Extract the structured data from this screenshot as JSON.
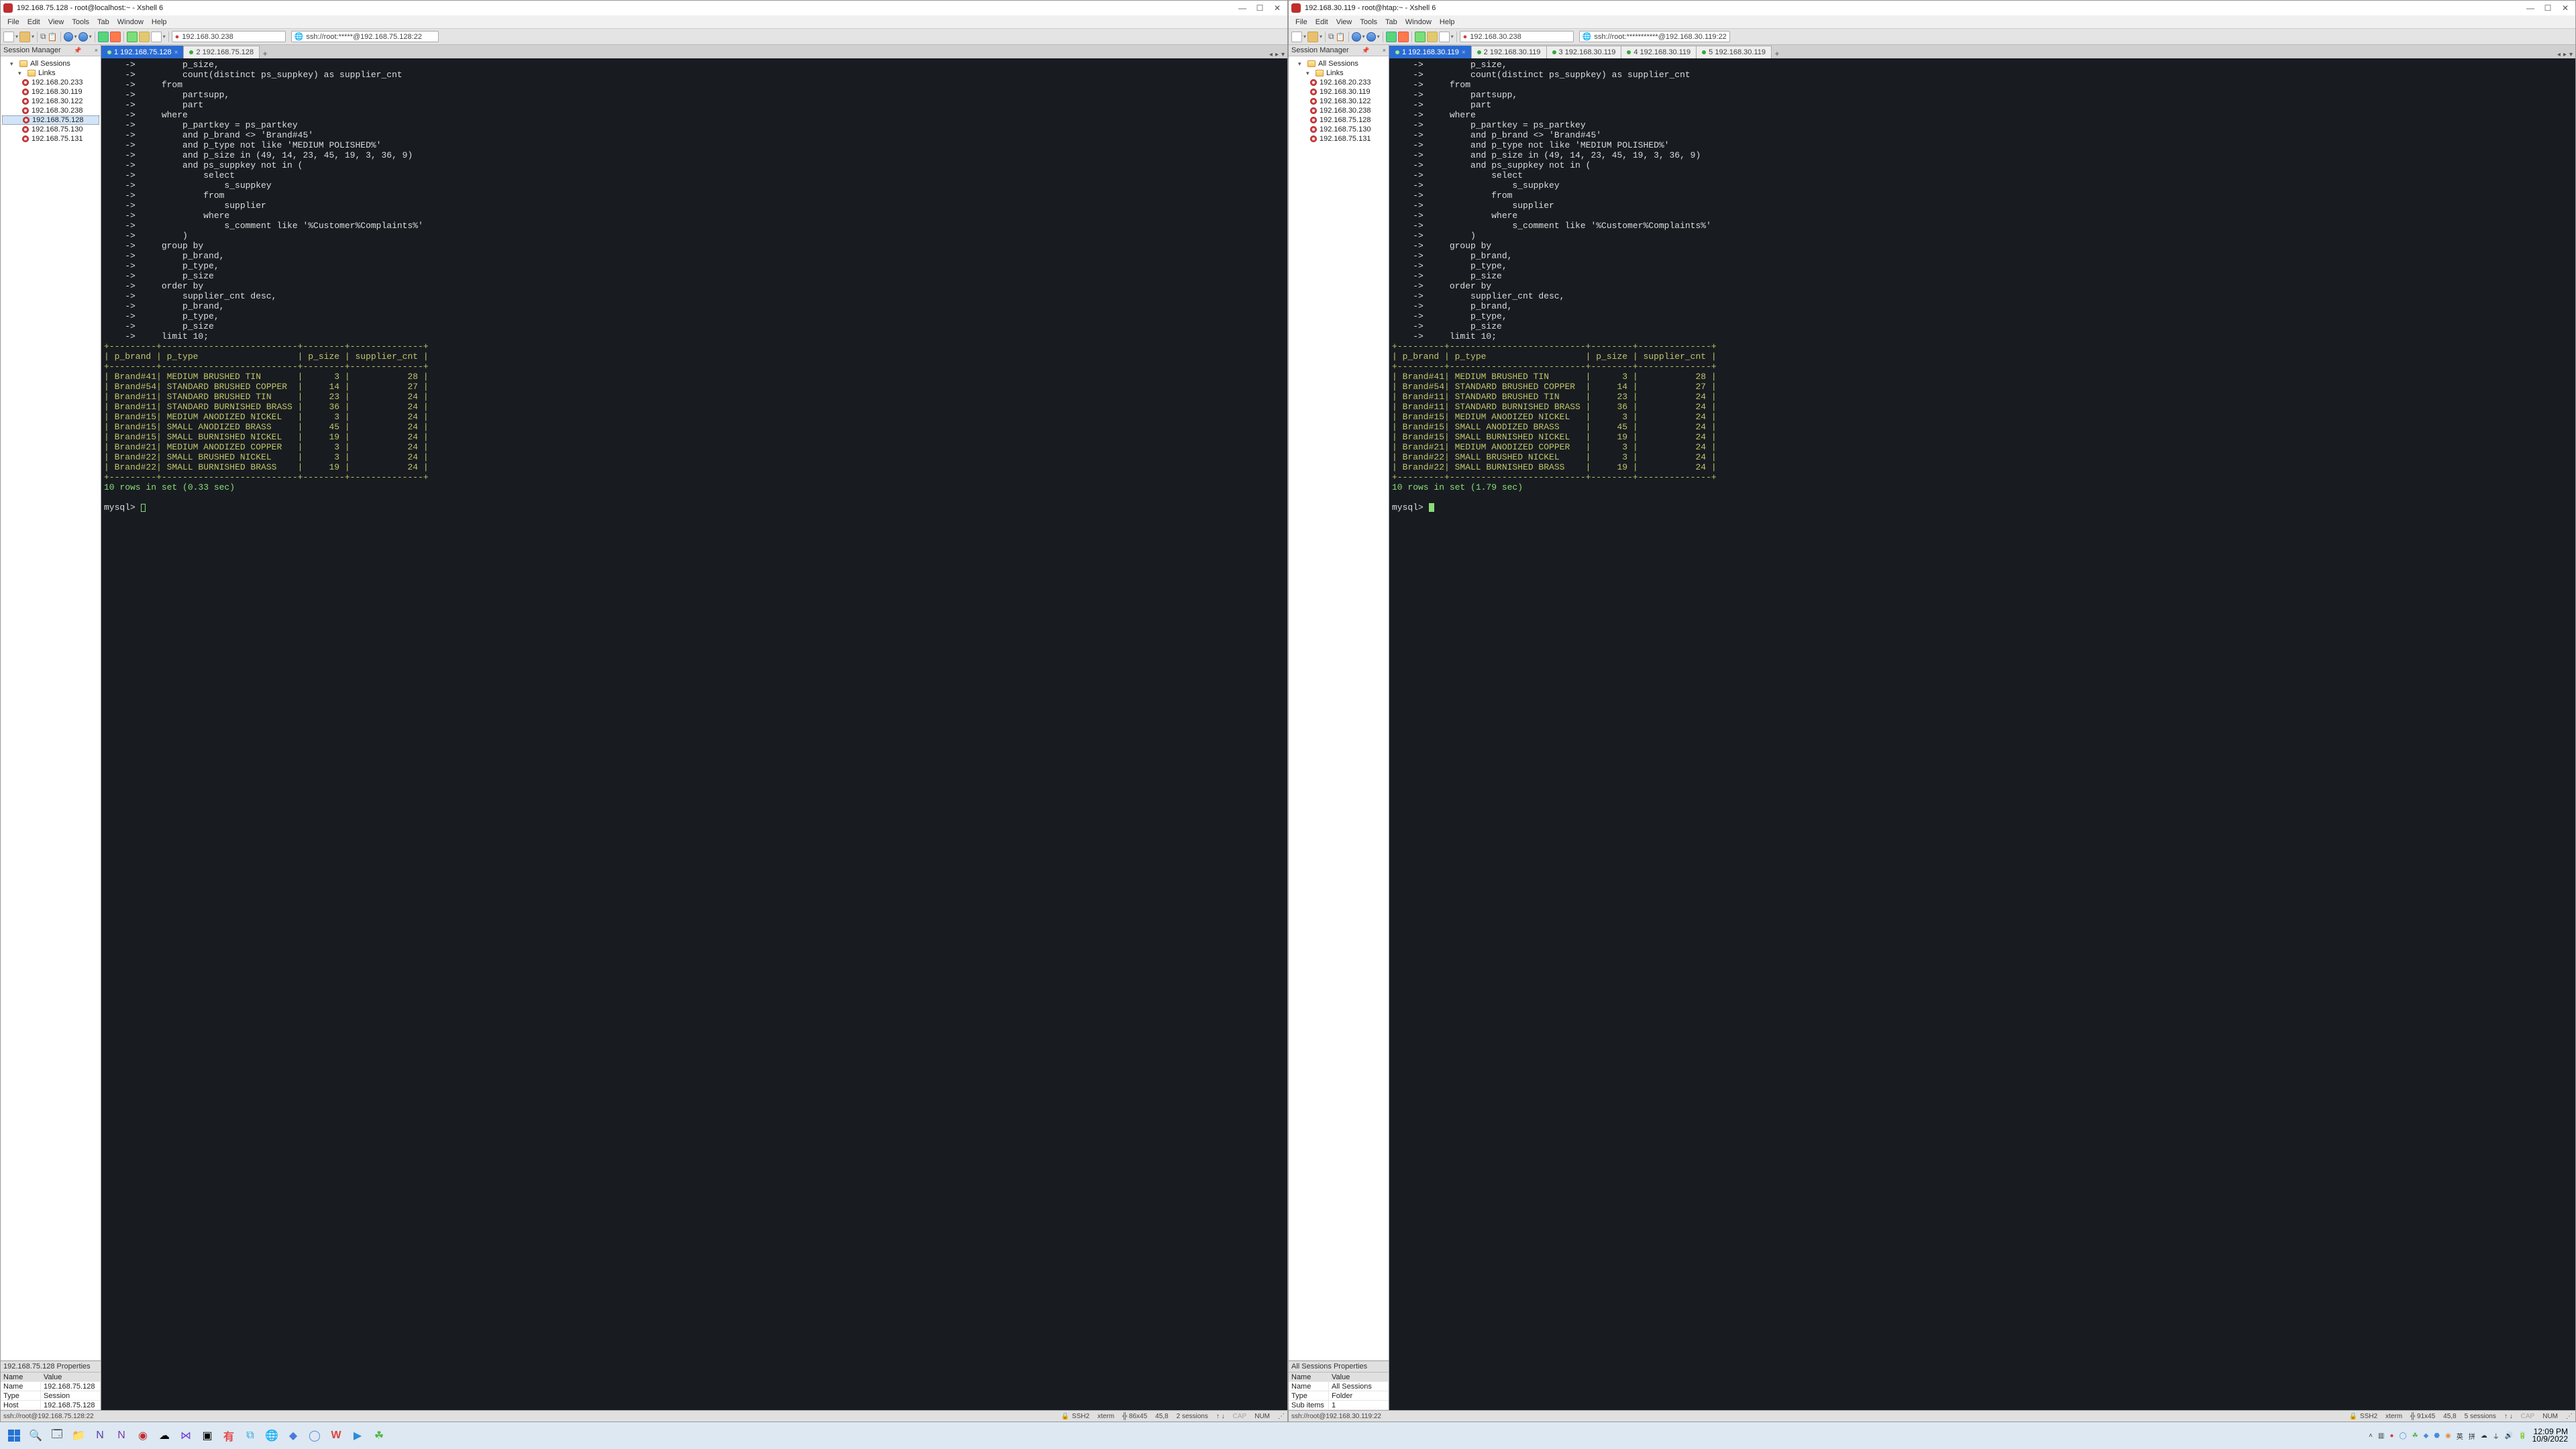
{
  "left": {
    "title": "192.168.75.128 - root@localhost:~ - Xshell 6",
    "address1": "192.168.30.238",
    "address2": "ssh://root:*****@192.168.75.128:22",
    "tabs": [
      {
        "bullet": true,
        "label": "1 192.168.75.128",
        "active": true,
        "close": true
      },
      {
        "bullet": true,
        "label": "2 192.168.75.128",
        "active": false,
        "close": false
      }
    ],
    "session_hdr": "Session Manager",
    "tree": {
      "root": "All Sessions",
      "links": "Links",
      "hosts": [
        "192.168.20.233",
        "192.168.30.119",
        "192.168.30.122",
        "192.168.30.238",
        "192.168.75.128",
        "192.168.75.130",
        "192.168.75.131"
      ],
      "selected": "192.168.75.128"
    },
    "prop_title": "192.168.75.128 Properties",
    "props": [
      [
        "Name",
        "Value"
      ],
      [
        "Name",
        "192.168.75.128"
      ],
      [
        "Type",
        "Session"
      ],
      [
        "Host",
        "192.168.75.128"
      ]
    ],
    "status": {
      "left": "ssh://root@192.168.75.128:22",
      "ssh": "SSH2",
      "term": "xterm",
      "dim": "86x45",
      "enc": "45,8",
      "sess": "2 sessions",
      "cap": "CAP",
      "num": "NUM"
    },
    "exec_time": "10 rows in set (0.33 sec)"
  },
  "right": {
    "title": "192.168.30.119 - root@htap:~ - Xshell 6",
    "address1": "192.168.30.238",
    "address2": "ssh://root:***********@192.168.30.119:22",
    "tabs": [
      {
        "bullet": true,
        "label": "1 192.168.30.119",
        "active": true,
        "close": true
      },
      {
        "bullet": true,
        "label": "2 192.168.30.119",
        "active": false,
        "close": false
      },
      {
        "bullet": true,
        "label": "3 192.168.30.119",
        "active": false,
        "close": false
      },
      {
        "bullet": true,
        "label": "4 192.168.30.119",
        "active": false,
        "close": false
      },
      {
        "bullet": true,
        "label": "5 192.168.30.119",
        "active": false,
        "close": false
      }
    ],
    "session_hdr": "Session Manager",
    "tree": {
      "root": "All Sessions",
      "links": "Links",
      "hosts": [
        "192.168.20.233",
        "192.168.30.119",
        "192.168.30.122",
        "192.168.30.238",
        "192.168.75.128",
        "192.168.75.130",
        "192.168.75.131"
      ],
      "selected": ""
    },
    "prop_title": "All Sessions Properties",
    "props": [
      [
        "Name",
        "Value"
      ],
      [
        "Name",
        "All Sessions"
      ],
      [
        "Type",
        "Folder"
      ],
      [
        "Sub items",
        "1"
      ]
    ],
    "status": {
      "left": "ssh://root@192.168.30.119:22",
      "ssh": "SSH2",
      "term": "xterm",
      "dim": "91x45",
      "enc": "45,8",
      "sess": "5 sessions",
      "cap": "CAP",
      "num": "NUM"
    },
    "exec_time": "10 rows in set (1.79 sec)"
  },
  "menu": [
    "File",
    "Edit",
    "View",
    "Tools",
    "Tab",
    "Window",
    "Help"
  ],
  "sql_lines": [
    "    ->         p_size,",
    "    ->         count(distinct ps_suppkey) as supplier_cnt",
    "    ->     from",
    "    ->         partsupp,",
    "    ->         part",
    "    ->     where",
    "    ->         p_partkey = ps_partkey",
    "    ->         and p_brand <> 'Brand#45'",
    "    ->         and p_type not like 'MEDIUM POLISHED%'",
    "    ->         and p_size in (49, 14, 23, 45, 19, 3, 36, 9)",
    "    ->         and ps_suppkey not in (",
    "    ->             select",
    "    ->                 s_suppkey",
    "    ->             from",
    "    ->                 supplier",
    "    ->             where",
    "    ->                 s_comment like '%Customer%Complaints%'",
    "    ->         )",
    "    ->     group by",
    "    ->         p_brand,",
    "    ->         p_type,",
    "    ->         p_size",
    "    ->     order by",
    "    ->         supplier_cnt desc,",
    "    ->         p_brand,",
    "    ->         p_type,",
    "    ->         p_size",
    "    ->     limit 10;"
  ],
  "table_sep": "+---------+--------------------------+--------+--------------+",
  "table_hdr": "| p_brand | p_type                   | p_size | supplier_cnt |",
  "table_rows": [
    "| Brand#41| MEDIUM BRUSHED TIN       |      3 |           28 |",
    "| Brand#54| STANDARD BRUSHED COPPER  |     14 |           27 |",
    "| Brand#11| STANDARD BRUSHED TIN     |     23 |           24 |",
    "| Brand#11| STANDARD BURNISHED BRASS |     36 |           24 |",
    "| Brand#15| MEDIUM ANODIZED NICKEL   |      3 |           24 |",
    "| Brand#15| SMALL ANODIZED BRASS     |     45 |           24 |",
    "| Brand#15| SMALL BURNISHED NICKEL   |     19 |           24 |",
    "| Brand#21| MEDIUM ANODIZED COPPER   |      3 |           24 |",
    "| Brand#22| SMALL BRUSHED NICKEL     |      3 |           24 |",
    "| Brand#22| SMALL BURNISHED BRASS    |     19 |           24 |"
  ],
  "prompt": "mysql> ",
  "chart_data": {
    "type": "table",
    "columns": [
      "p_brand",
      "p_type",
      "p_size",
      "supplier_cnt"
    ],
    "rows": [
      [
        "Brand#41",
        "MEDIUM BRUSHED TIN",
        3,
        28
      ],
      [
        "Brand#54",
        "STANDARD BRUSHED COPPER",
        14,
        27
      ],
      [
        "Brand#11",
        "STANDARD BRUSHED TIN",
        23,
        24
      ],
      [
        "Brand#11",
        "STANDARD BURNISHED BRASS",
        36,
        24
      ],
      [
        "Brand#15",
        "MEDIUM ANODIZED NICKEL",
        3,
        24
      ],
      [
        "Brand#15",
        "SMALL ANODIZED BRASS",
        45,
        24
      ],
      [
        "Brand#15",
        "SMALL BURNISHED NICKEL",
        19,
        24
      ],
      [
        "Brand#21",
        "MEDIUM ANODIZED COPPER",
        3,
        24
      ],
      [
        "Brand#22",
        "SMALL BRUSHED NICKEL",
        3,
        24
      ],
      [
        "Brand#22",
        "SMALL BURNISHED BRASS",
        19,
        24
      ]
    ]
  },
  "clock": {
    "time": "12:09 PM",
    "date": "10/9/2022"
  },
  "ime": {
    "a": "英",
    "b": "拼"
  }
}
